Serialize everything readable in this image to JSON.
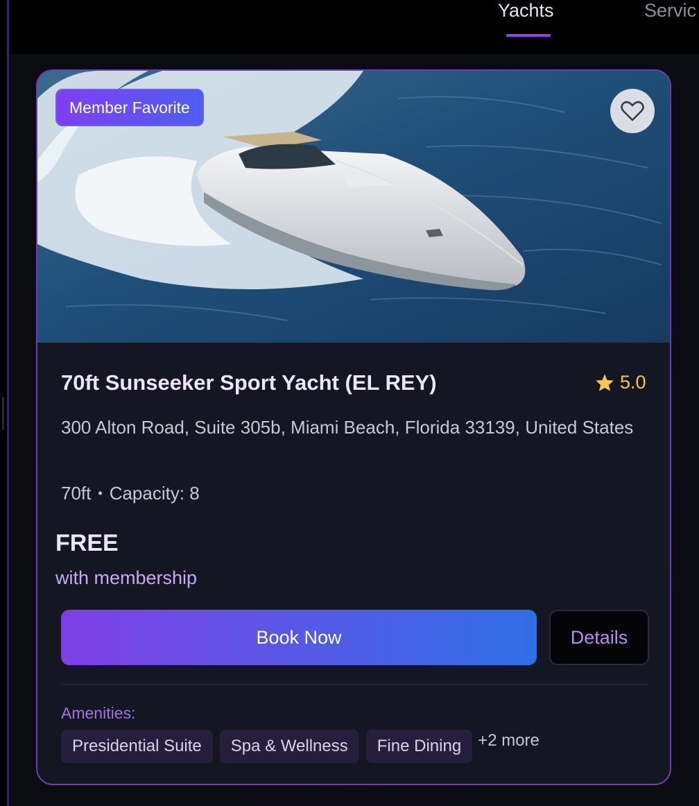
{
  "nav": {
    "tabs": [
      {
        "label": "Yachts",
        "active": true
      },
      {
        "label": "Servic",
        "active": false
      }
    ]
  },
  "card": {
    "badge": "Member Favorite",
    "favorite_icon": "heart-outline-icon",
    "title": "70ft Sunseeker Sport Yacht (EL REY)",
    "rating": "5.0",
    "rating_icon": "star-icon",
    "address": "300 Alton Road, Suite 305b, Miami Beach, Florida 33139, United States",
    "length": "70ft",
    "separator": "•",
    "capacity": "Capacity: 8",
    "price": "FREE",
    "price_note": "with membership",
    "book_label": "Book Now",
    "details_label": "Details",
    "amenities_label": "Amenities:",
    "amenities": [
      "Presidential Suite",
      "Spa & Wellness",
      "Fine Dining"
    ],
    "more_amenities": "+2 more"
  },
  "colors": {
    "accent_purple": "#7e3fe4",
    "accent_blue": "#2f6fe5",
    "rating_gold": "#f2c94c",
    "card_border": "#6b3fae"
  }
}
